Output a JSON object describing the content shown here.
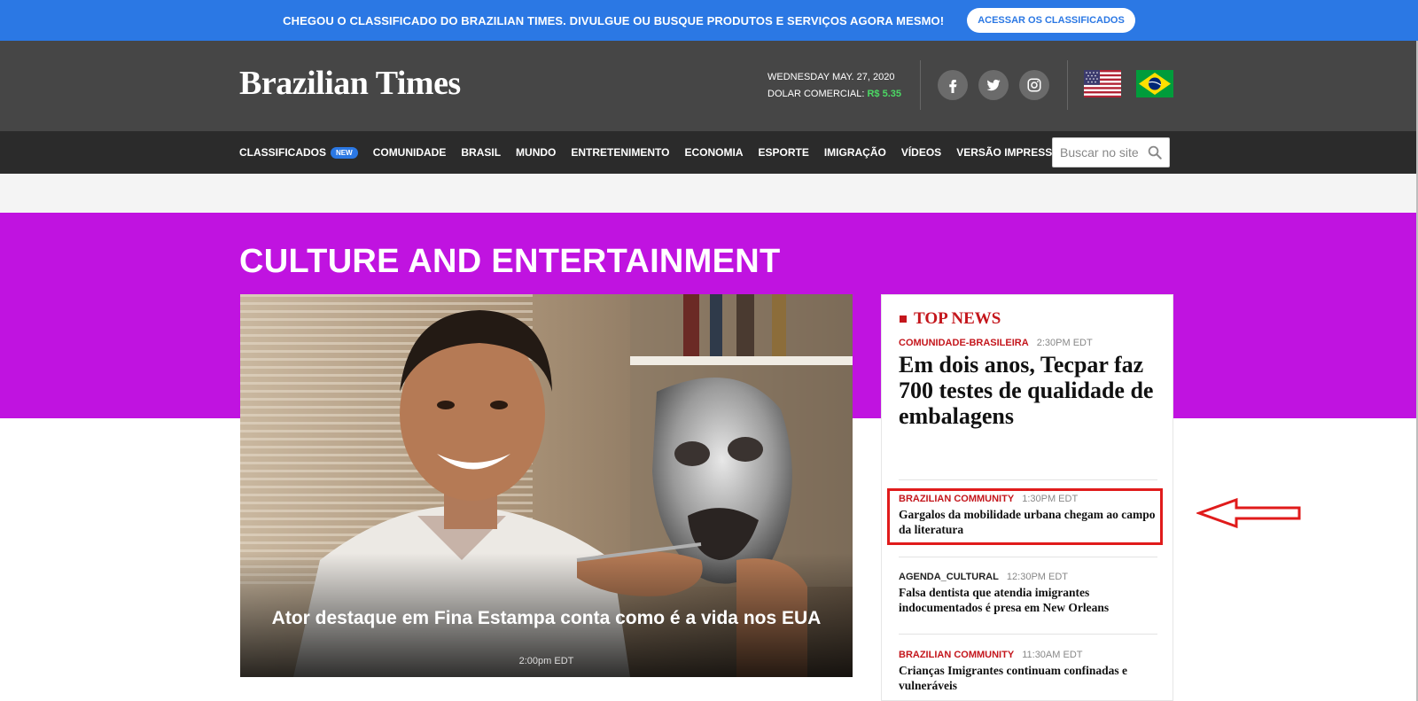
{
  "promo": {
    "text": "CHEGOU O CLASSIFICADO DO BRAZILIAN TIMES. DIVULGUE OU BUSQUE PRODUTOS E SERVIÇOS AGORA MESMO!",
    "button_label": "ACESSAR OS CLASSIFICADOS"
  },
  "header": {
    "logo": "Brazilian Times",
    "date": "WEDNESDAY MAY. 27, 2020",
    "dolar_label": "DOLAR COMERCIAL:",
    "dolar_value": "R$ 5.35",
    "social_icons": [
      "facebook-icon",
      "twitter-icon",
      "instagram-icon"
    ],
    "flags": [
      "us-flag",
      "brazil-flag"
    ]
  },
  "nav": {
    "items": [
      {
        "label": "CLASSIFICADOS",
        "badge": "NEW"
      },
      {
        "label": "COMUNIDADE"
      },
      {
        "label": "BRASIL"
      },
      {
        "label": "MUNDO"
      },
      {
        "label": "ENTRETENIMENTO"
      },
      {
        "label": "ECONOMIA"
      },
      {
        "label": "ESPORTE"
      },
      {
        "label": "IMIGRAÇÃO"
      },
      {
        "label": "VÍDEOS"
      },
      {
        "label": "VERSÃO IMPRESSA"
      }
    ],
    "search_placeholder": "Buscar no site"
  },
  "section": {
    "title": "CULTURE AND ENTERTAINMENT"
  },
  "hero": {
    "title": "Ator destaque em Fina Estampa conta como é a vida nos EUA",
    "time": "2:00pm EDT"
  },
  "top_news": {
    "title": "TOP NEWS",
    "items": [
      {
        "category": "COMUNIDADE-BRASILEIRA",
        "time": "2:30PM EDT",
        "headline": "Em dois anos, Tecpar faz 700 testes de qualidade de embalagens"
      },
      {
        "category": "BRAZILIAN COMMUNITY",
        "time": "1:30PM EDT",
        "headline": "Gargalos da mobilidade urbana chegam ao campo da literatura"
      },
      {
        "category": "AGENDA_CULTURAL",
        "time": "12:30PM EDT",
        "headline": "Falsa dentista que atendia imigrantes indocumentados é presa em New Orleans"
      },
      {
        "category": "BRAZILIAN COMMUNITY",
        "time": "11:30AM EDT",
        "headline": "Crianças Imigrantes continuam confinadas e vulneráveis"
      }
    ]
  },
  "colors": {
    "promo_blue": "#2b78e4",
    "header_gray": "#464646",
    "nav_dark": "#2b2b2b",
    "section_purple": "#c013e0",
    "news_red": "#c4161c",
    "dolar_green": "#4cd964",
    "annotation_red": "#e01b1b"
  }
}
